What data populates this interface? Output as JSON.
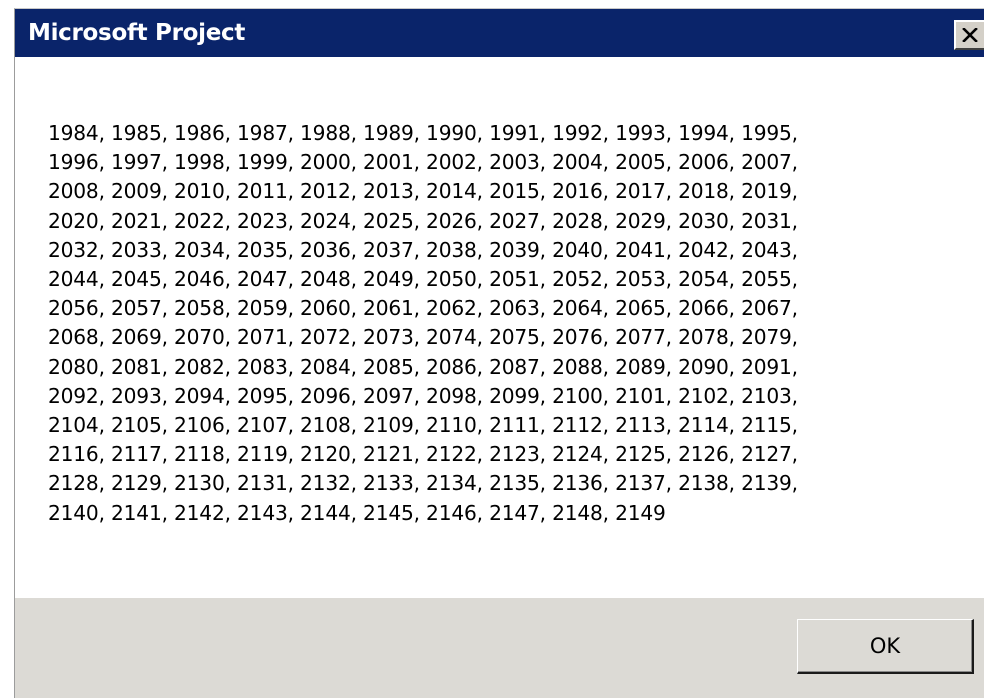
{
  "dialog": {
    "title": "Microsoft Project",
    "message": "1984, 1985, 1986, 1987, 1988, 1989, 1990, 1991, 1992, 1993, 1994, 1995,\n1996, 1997, 1998, 1999, 2000, 2001, 2002, 2003, 2004, 2005, 2006, 2007,\n2008, 2009, 2010, 2011, 2012, 2013, 2014, 2015, 2016, 2017, 2018, 2019,\n2020, 2021, 2022, 2023, 2024, 2025, 2026, 2027, 2028, 2029, 2030, 2031,\n2032, 2033, 2034, 2035, 2036, 2037, 2038, 2039, 2040, 2041, 2042, 2043,\n2044, 2045, 2046, 2047, 2048, 2049, 2050, 2051, 2052, 2053, 2054, 2055,\n2056, 2057, 2058, 2059, 2060, 2061, 2062, 2063, 2064, 2065, 2066, 2067,\n2068, 2069, 2070, 2071, 2072, 2073, 2074, 2075, 2076, 2077, 2078, 2079,\n2080, 2081, 2082, 2083, 2084, 2085, 2086, 2087, 2088, 2089, 2090, 2091,\n2092, 2093, 2094, 2095, 2096, 2097, 2098, 2099, 2100, 2101, 2102, 2103,\n2104, 2105, 2106, 2107, 2108, 2109, 2110, 2111, 2112, 2113, 2114, 2115,\n2116, 2117, 2118, 2119, 2120, 2121, 2122, 2123, 2124, 2125, 2126, 2127,\n2128, 2129, 2130, 2131, 2132, 2133, 2134, 2135, 2136, 2137, 2138, 2139,\n2140, 2141, 2142, 2143, 2144, 2145, 2146, 2147, 2148, 2149",
    "ok_label": "OK",
    "close_icon": "close-icon"
  },
  "colors": {
    "titlebar": "#0a246a",
    "title_text": "#ffffff",
    "dialog_background": "#ffffff",
    "footer_background": "#dcdad5",
    "button_face": "#d4d0c8"
  }
}
